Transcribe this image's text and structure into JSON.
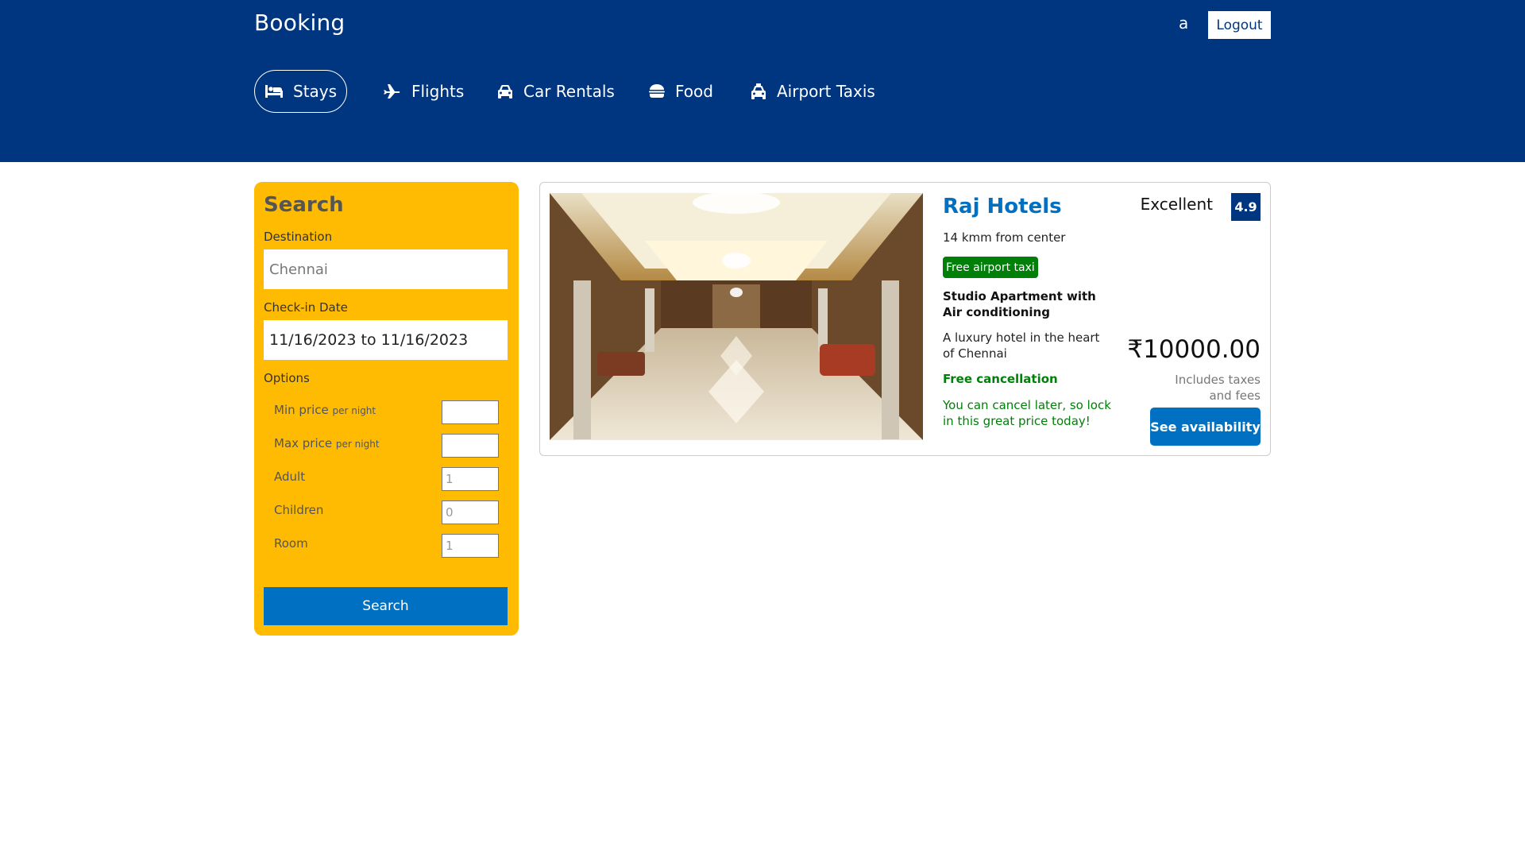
{
  "header": {
    "logo": "Booking",
    "user_name": "a",
    "logout_label": "Logout"
  },
  "nav": {
    "items": [
      {
        "label": "Stays",
        "icon": "bed-icon",
        "active": true
      },
      {
        "label": "Flights",
        "icon": "plane-icon",
        "active": false
      },
      {
        "label": "Car Rentals",
        "icon": "car-icon",
        "active": false
      },
      {
        "label": "Food",
        "icon": "burger-icon",
        "active": false
      },
      {
        "label": "Airport Taxis",
        "icon": "taxi-icon",
        "active": false
      }
    ]
  },
  "search": {
    "title": "Search",
    "destination_label": "Destination",
    "destination_value": "Chennai",
    "checkin_label": "Check-in Date",
    "checkin_value": "11/16/2023 to 11/16/2023",
    "options_label": "Options",
    "options": [
      {
        "label": "Min price",
        "suffix": "per night",
        "value": ""
      },
      {
        "label": "Max price",
        "suffix": "per night",
        "value": ""
      },
      {
        "label": "Adult",
        "suffix": "",
        "value": "1"
      },
      {
        "label": "Children",
        "suffix": "",
        "value": "0"
      },
      {
        "label": "Room",
        "suffix": "",
        "value": "1"
      }
    ],
    "button_label": "Search"
  },
  "result": {
    "name": "Raj Hotels",
    "distance": "14 kmm from center",
    "taxi_badge": "Free airport taxi",
    "room_type": "Studio Apartment with Air conditioning",
    "description": "A luxury hotel in the heart of Chennai",
    "free_cancellation": "Free cancellation",
    "cancel_note": "You can cancel later, so lock in this great price today!",
    "rating_text": "Excellent",
    "rating_value": "4.9",
    "price": "₹10000.00",
    "tax_note": "Includes taxes and fees",
    "button_label": "See availability"
  },
  "colors": {
    "brand_blue": "#003580",
    "action_blue": "#0071c2",
    "search_panel": "#febb02",
    "green": "#008009"
  }
}
